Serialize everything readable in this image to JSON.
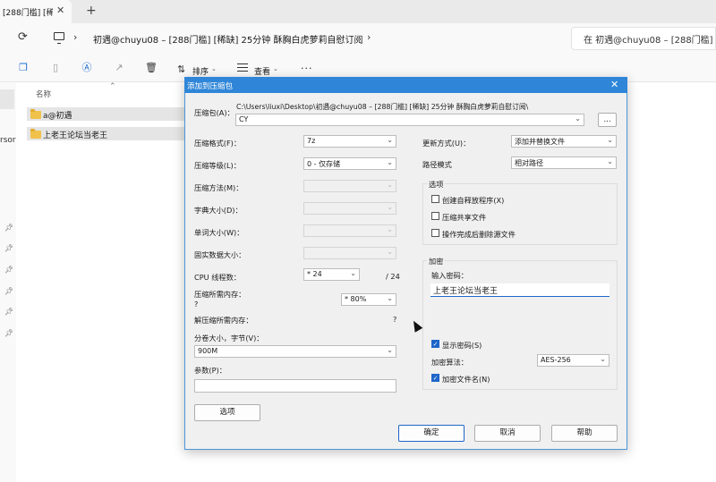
{
  "browser": {
    "tab_title": "[288门槛] [稀",
    "tab_close": "✕",
    "new_tab": "+"
  },
  "address": {
    "breadcrumb": "初遇@chuyu08 – [288门槛] [稀缺] 25分钟 酥胸白虎萝莉自慰订阅",
    "search_text": "在 初遇@chuyu08 – [288门槛] [稀"
  },
  "toolbar": {
    "sort_label": "排序",
    "view_label": "查看",
    "more": "···"
  },
  "filelist": {
    "column_name": "名称",
    "items": [
      {
        "name": "a@初遇"
      },
      {
        "name": "上老王论坛当老王"
      }
    ],
    "nav_fragment": "rsor"
  },
  "dialog": {
    "title": "添加到压缩包",
    "close": "✕",
    "archive_label": "压缩包(A)：",
    "archive_path": "C:\\Users\\liuxi\\Desktop\\初遇@chuyu08 – [288门槛] [稀缺] 25分钟 酥胸白虎萝莉自慰订阅\\",
    "archive_name": "CY",
    "browse": "...",
    "format_label": "压缩格式(F)：",
    "format_value": "7z",
    "level_label": "压缩等级(L)：",
    "level_value": "0 - 仅存储",
    "method_label": "压缩方法(M)：",
    "dict_label": "字典大小(D)：",
    "word_label": "单词大小(W)：",
    "solid_label": "固实数据大小：",
    "cpu_label": "CPU 线程数：",
    "cpu_value": "* 24",
    "cpu_max": "/ 24",
    "mem_comp_label": "压缩所需内存：",
    "mem_comp_q": "?",
    "mem_comp_value": "* 80%",
    "mem_decomp_label": "解压缩所需内存：",
    "mem_decomp_q": "?",
    "split_label": "分卷大小，字节(V)：",
    "split_value": "900M",
    "params_label": "参数(P)：",
    "params_value": "",
    "options_button": "选项",
    "update_label": "更新方式(U)：",
    "update_value": "添加并替换文件",
    "pathmode_label": "路径模式",
    "pathmode_value": "相对路径",
    "options_group": "选项",
    "opt_sfx": "创建自释放程序(X)",
    "opt_shared": "压缩共享文件",
    "opt_delete": "操作完成后删除源文件",
    "encrypt_group": "加密",
    "pw_label": "输入密码：",
    "pw_value": "上老王论坛当老王",
    "show_pw": "显示密码(S)",
    "enc_method_label": "加密算法：",
    "enc_method_value": "AES-256",
    "enc_names": "加密文件名(N)",
    "ok": "确定",
    "cancel": "取消",
    "help": "帮助"
  }
}
